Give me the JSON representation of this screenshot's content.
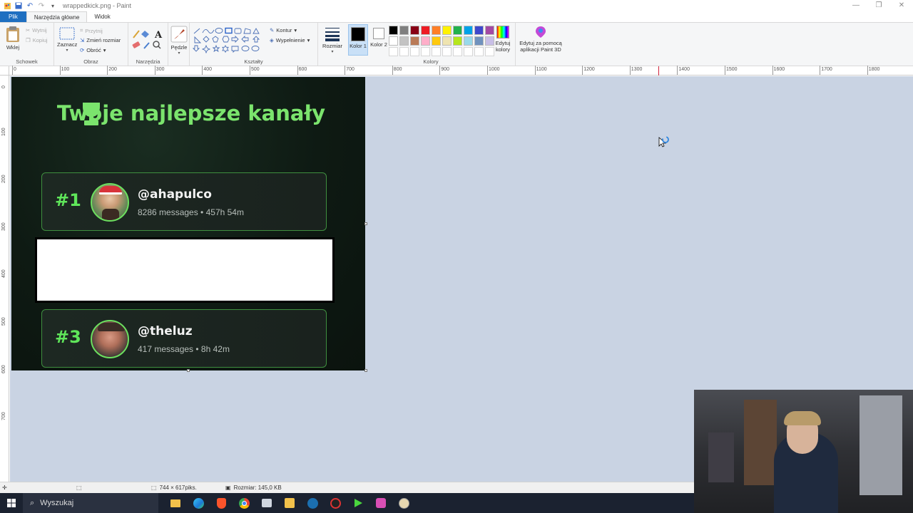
{
  "window": {
    "title": "wrappedkick.png - Paint",
    "controls": [
      "—",
      "❐",
      "✕"
    ]
  },
  "tabs": [
    {
      "label": "Plik"
    },
    {
      "label": "Narzędzia główne"
    },
    {
      "label": "Widok"
    }
  ],
  "ribbon": {
    "clipboard": {
      "paste": "Wklej",
      "cut": "Wytnij",
      "copy": "Kopiuj",
      "group": "Schowek"
    },
    "image": {
      "select": "Zaznacz",
      "crop": "Przytnij",
      "resize": "Zmień rozmiar",
      "rotate": "Obróć",
      "group": "Obraz"
    },
    "tools": {
      "group": "Narzędzia"
    },
    "brushes": {
      "label": "Pędzle"
    },
    "shapes": {
      "outline": "Kontur",
      "fill": "Wypełnienie",
      "group": "Kształty"
    },
    "size": {
      "label": "Rozmiar"
    },
    "color1": {
      "label": "Kolor 1",
      "value": "#000000"
    },
    "color2": {
      "label": "Kolor 2",
      "value": "#ffffff"
    },
    "colors": {
      "group": "Kolory"
    },
    "edit_colors": "Edytuj kolory",
    "paint3d": "Edytuj za pomocą aplikacji Paint 3D",
    "palette": [
      "#000000",
      "#7f7f7f",
      "#880015",
      "#ed1c24",
      "#ff7f27",
      "#fff200",
      "#22b14c",
      "#00a2e8",
      "#3f48cc",
      "#a349a4",
      "#ffffff",
      "#c3c3c3",
      "#b97a57",
      "#ffaec9",
      "#ffc90e",
      "#efe4b0",
      "#b5e61d",
      "#99d9ea",
      "#7092be",
      "#c8bfe7",
      "#ffffff",
      "#ffffff",
      "#ffffff",
      "#ffffff",
      "#ffffff",
      "#ffffff",
      "#ffffff",
      "#ffffff",
      "#ffffff",
      "#ffffff"
    ]
  },
  "ruler": {
    "h_labels": [
      "0",
      "100",
      "200",
      "300",
      "400",
      "500",
      "600",
      "700",
      "800",
      "900",
      "1000",
      "1100",
      "1200",
      "1300",
      "1400",
      "1500",
      "1600",
      "1700",
      "1800"
    ],
    "v_labels": [
      "0",
      "100",
      "200",
      "300",
      "400",
      "500",
      "600",
      "700"
    ]
  },
  "image": {
    "title": "Twoje najlepsze kanały",
    "cards": [
      {
        "rank": "#1",
        "handle": "@ahapulco",
        "stats": "8286 messages • 457h 54m"
      },
      {
        "rank": "#3",
        "handle": "@theluz",
        "stats": "417 messages • 8h 42m"
      }
    ]
  },
  "status": {
    "dimensions": "744 × 617piks.",
    "size": "Rozmiar: 145,0 KB"
  },
  "taskbar": {
    "search": "Wyszukaj"
  }
}
